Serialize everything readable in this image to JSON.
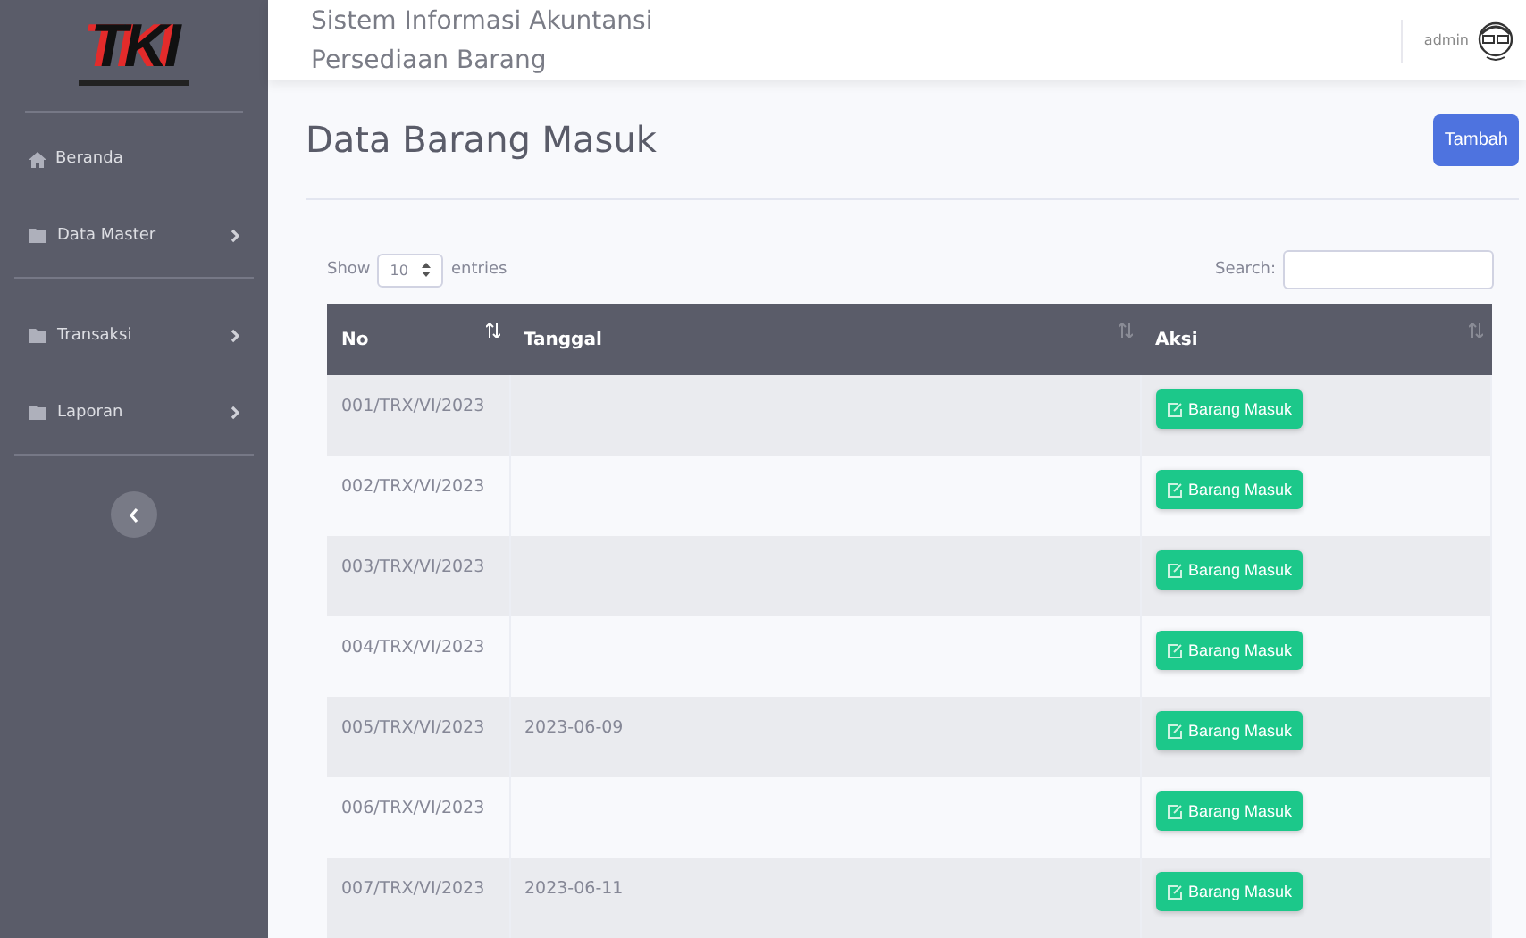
{
  "sidebar": {
    "logo": "TKI",
    "items": [
      {
        "label": "Beranda",
        "kind": "home",
        "has_submenu": false,
        "divider_after": false
      },
      {
        "label": "Data Master",
        "kind": "folder",
        "has_submenu": true,
        "divider_after": true
      },
      {
        "label": "Transaksi",
        "kind": "folder",
        "has_submenu": true,
        "divider_after": false
      },
      {
        "label": "Laporan",
        "kind": "folder",
        "has_submenu": true,
        "divider_after": true
      }
    ]
  },
  "header": {
    "title_line_1": "Sistem Informasi Akuntansi",
    "title_line_2": "Persediaan Barang",
    "user": "admin"
  },
  "page": {
    "title": "Data Barang Masuk",
    "add_button": "Tambah"
  },
  "table_controls": {
    "show_label": "Show",
    "page_size": "10",
    "entries_label": "entries",
    "search_label": "Search:"
  },
  "table": {
    "columns": [
      "No",
      "Tanggal",
      "Aksi"
    ],
    "rows": [
      {
        "no": "001/TRX/VI/2023",
        "tanggal": "",
        "action": "Barang Masuk"
      },
      {
        "no": "002/TRX/VI/2023",
        "tanggal": "",
        "action": "Barang Masuk"
      },
      {
        "no": "003/TRX/VI/2023",
        "tanggal": "",
        "action": "Barang Masuk"
      },
      {
        "no": "004/TRX/VI/2023",
        "tanggal": "",
        "action": "Barang Masuk"
      },
      {
        "no": "005/TRX/VI/2023",
        "tanggal": "2023-06-09",
        "action": "Barang Masuk"
      },
      {
        "no": "006/TRX/VI/2023",
        "tanggal": "",
        "action": "Barang Masuk"
      },
      {
        "no": "007/TRX/VI/2023",
        "tanggal": "2023-06-11",
        "action": "Barang Masuk"
      }
    ]
  }
}
